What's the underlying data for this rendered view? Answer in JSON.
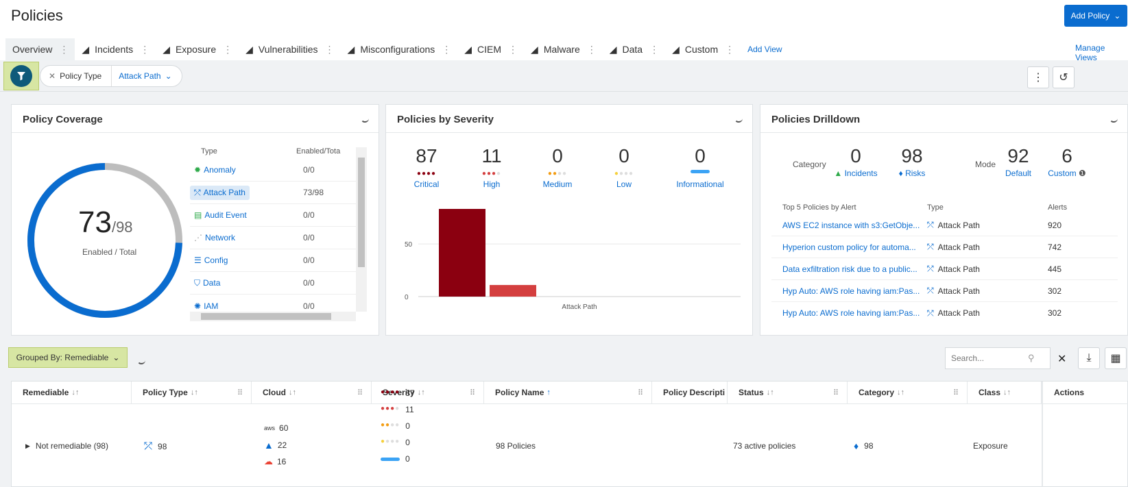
{
  "page": {
    "title": "Policies",
    "add_policy_label": "Add Policy"
  },
  "tabs": [
    {
      "label": "Overview"
    },
    {
      "label": "Incidents"
    },
    {
      "label": "Exposure"
    },
    {
      "label": "Vulnerabilities"
    },
    {
      "label": "Misconfigurations"
    },
    {
      "label": "CIEM"
    },
    {
      "label": "Malware"
    },
    {
      "label": "Data"
    },
    {
      "label": "Custom"
    }
  ],
  "add_view_label": "Add View",
  "manage_views_label": "Manage Views",
  "filter": {
    "chip_label": "Policy Type",
    "chip_value": "Attack Path"
  },
  "coverage": {
    "title": "Policy Coverage",
    "enabled": "73",
    "total": "/98",
    "enabled_fraction": 0.745,
    "caption": "Enabled / Total",
    "col_type": "Type",
    "col_enabled": "Enabled/Tota",
    "rows": [
      {
        "name": "Anomaly",
        "value": "0/0"
      },
      {
        "name": "Attack Path",
        "value": "73/98"
      },
      {
        "name": "Audit Event",
        "value": "0/0"
      },
      {
        "name": "Network",
        "value": "0/0"
      },
      {
        "name": "Config",
        "value": "0/0"
      },
      {
        "name": "Data",
        "value": "0/0"
      },
      {
        "name": "IAM",
        "value": "0/0"
      }
    ]
  },
  "severity": {
    "title": "Policies by Severity",
    "stats": [
      {
        "value": "87",
        "label": "Critical",
        "color": "#8b0010"
      },
      {
        "value": "11",
        "label": "High",
        "color": "#d43f3f"
      },
      {
        "value": "0",
        "label": "Medium",
        "color": "#f39c12"
      },
      {
        "value": "0",
        "label": "Low",
        "color": "#f5d03b"
      },
      {
        "value": "0",
        "label": "Informational",
        "color": "#3ba3f5"
      }
    ]
  },
  "chart_data": {
    "type": "bar",
    "categories": [
      "Attack Path"
    ],
    "series": [
      {
        "name": "Critical",
        "values": [
          87
        ],
        "color": "#8b0010"
      },
      {
        "name": "High",
        "values": [
          11
        ],
        "color": "#d43f3f"
      }
    ],
    "y_ticks": [
      "0",
      "50"
    ],
    "ylim": [
      0,
      100
    ],
    "xlabel": "Attack Path"
  },
  "drilldown": {
    "title": "Policies Drilldown",
    "category_caption": "Category",
    "incidents": {
      "value": "0",
      "label": "Incidents"
    },
    "risks": {
      "value": "98",
      "label": "Risks"
    },
    "mode_caption": "Mode",
    "default": {
      "value": "92",
      "label": "Default"
    },
    "custom": {
      "value": "6",
      "label": "Custom"
    },
    "top5_title": "Top 5 Policies by Alert",
    "col_type": "Type",
    "col_alerts": "Alerts",
    "rows": [
      {
        "name": "AWS EC2 instance with s3:GetObje...",
        "type": "Attack Path",
        "alerts": "920"
      },
      {
        "name": "Hyperion custom policy for automa...",
        "type": "Attack Path",
        "alerts": "742"
      },
      {
        "name": "Data exfiltration risk due to a public...",
        "type": "Attack Path",
        "alerts": "445"
      },
      {
        "name": "Hyp Auto: AWS role having iam:Pas...",
        "type": "Attack Path",
        "alerts": "302"
      },
      {
        "name": "Hyp Auto: AWS role having iam:Pas...",
        "type": "Attack Path",
        "alerts": "302"
      }
    ]
  },
  "grouping": {
    "label": "Grouped By: Remediable"
  },
  "search": {
    "placeholder": "Search..."
  },
  "table": {
    "headers": [
      "Remediable",
      "Policy Type",
      "Cloud",
      "Severity",
      "Policy Name",
      "Policy Descripti",
      "Status",
      "Category",
      "Class",
      "Actions"
    ],
    "row": {
      "group": "Not remediable (98)",
      "policy_type_count": "98",
      "clouds": [
        {
          "name": "aws",
          "count": "60"
        },
        {
          "name": "azure",
          "count": "22"
        },
        {
          "name": "gcp",
          "count": "16"
        }
      ],
      "severity": [
        {
          "count": "87",
          "color": "#8b0010"
        },
        {
          "count": "11",
          "color": "#d43f3f"
        },
        {
          "count": "0",
          "color": "#f39c12"
        },
        {
          "count": "0",
          "color": "#f5d03b"
        },
        {
          "count": "0",
          "color": "#3ba3f5"
        }
      ],
      "policy_name": "98 Policies",
      "status": "73 active policies",
      "category_count": "98",
      "class": "Exposure"
    }
  }
}
